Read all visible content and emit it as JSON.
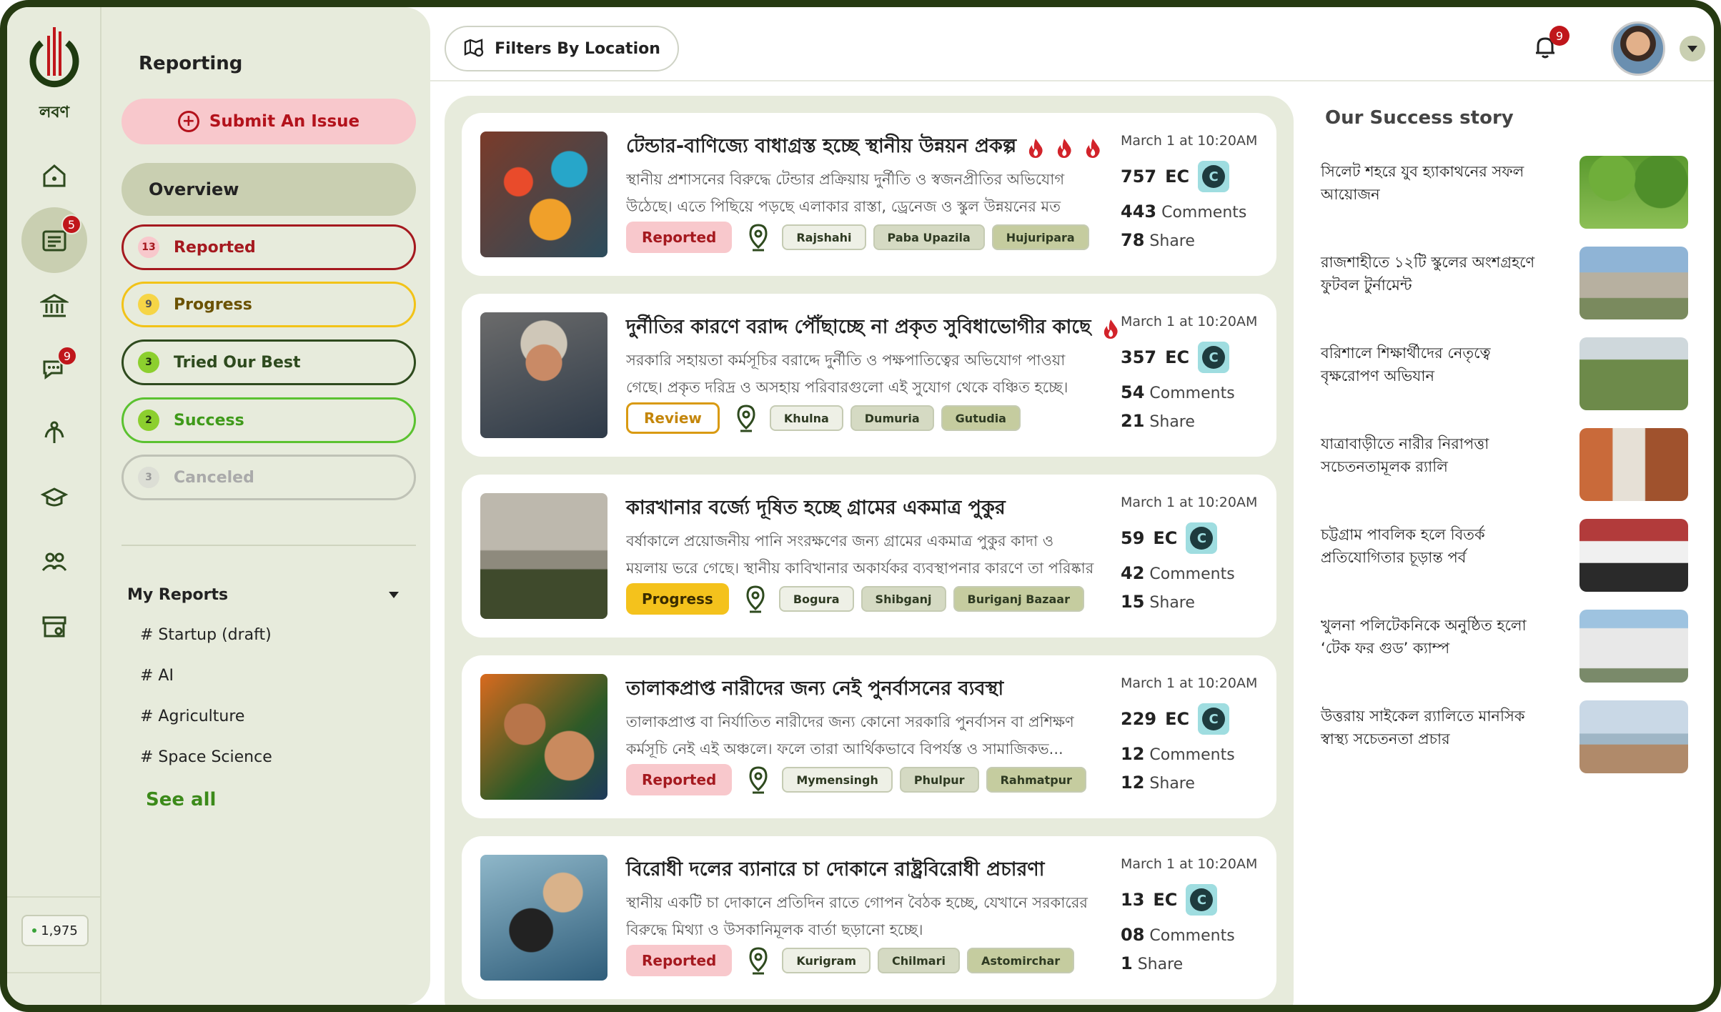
{
  "brand": {
    "logo_text": "লবণ"
  },
  "rail": {
    "items": [
      {
        "name": "home",
        "badge": ""
      },
      {
        "name": "reports",
        "badge": "5",
        "active": true
      },
      {
        "name": "institution",
        "badge": ""
      },
      {
        "name": "messages",
        "badge": "9"
      },
      {
        "name": "agriculture",
        "badge": ""
      },
      {
        "name": "education",
        "badge": ""
      },
      {
        "name": "community",
        "badge": ""
      },
      {
        "name": "marketplace",
        "badge": ""
      }
    ],
    "points": "1,975"
  },
  "sidebar": {
    "title": "Reporting",
    "submit_label": "Submit An Issue",
    "overview_label": "Overview",
    "statuses": [
      {
        "count": "13",
        "label": "Reported"
      },
      {
        "count": "9",
        "label": "Progress"
      },
      {
        "count": "3",
        "label": "Tried Our Best"
      },
      {
        "count": "2",
        "label": "Success"
      },
      {
        "count": "3",
        "label": "Canceled"
      }
    ],
    "my_reports_label": "My Reports",
    "my_reports": [
      "# Startup (draft)",
      "# AI",
      "# Agriculture",
      "# Space Science"
    ],
    "see_all": "See all"
  },
  "header": {
    "filter_label": "Filters By Location",
    "notification_count": "9"
  },
  "feed": [
    {
      "title": "টেন্ডার-বাণিজ্যে বাধাগ্রস্ত হচ্ছে স্থানীয় উন্নয়ন প্রকল্প",
      "fires": 3,
      "desc": "স্থানীয় প্রশাসনের বিরুদ্ধে টেন্ডার প্রক্রিয়ায় দুর্নীতি ও স্বজনপ্রীতির অভিযোগ উঠেছে। এতে পিছিয়ে পড়ছে এলাকার রাস্তা, ড্রেনেজ ও স্কুল উন্নয়নের মত গুরুত্বপূর্ণ প্রকল্প।",
      "status": "Reported",
      "locations": [
        "Rajshahi",
        "Paba Upazila",
        "Hujuripara"
      ],
      "date": "March 1 at 10:20AM",
      "ec": "757",
      "ec_label": "EC",
      "comments": "443",
      "comments_label": "Comments",
      "shares": "78",
      "shares_label": "Share"
    },
    {
      "title": "দুর্নীতির কারণে বরাদ্দ পৌঁছাচ্ছে না প্রকৃত সুবিধাভোগীর কাছে",
      "fires": 1,
      "desc": "সরকারি সহায়তা কর্মসূচির বরাদ্দে দুর্নীতি ও পক্ষপাতিত্বের অভিযোগ পাওয়া গেছে। প্রকৃত দরিদ্র ও অসহায় পরিবারগুলো এই সুযোগ থেকে বঞ্চিত হচ্ছে।",
      "status": "Review",
      "locations": [
        "Khulna",
        "Dumuria",
        "Gutudia"
      ],
      "date": "March 1 at 10:20AM",
      "ec": "357",
      "ec_label": "EC",
      "comments": "54",
      "comments_label": "Comments",
      "shares": "21",
      "shares_label": "Share"
    },
    {
      "title": "কারখানার বর্জ্যে দূষিত হচ্ছে গ্রামের একমাত্র পুকুর",
      "fires": 0,
      "desc": "বর্ষাকালে প্রয়োজনীয় পানি সংরক্ষণের জন্য গ্রামের একমাত্র পুকুর কাদা ও ময়লায় ভরে গেছে। স্থানীয় কাবিখানার অকার্যকর ব্যবস্থাপনার কারণে তা পরিষ্কার করা।",
      "status": "Progress",
      "locations": [
        "Bogura",
        "Shibganj",
        "Buriganj Bazaar"
      ],
      "date": "March 1 at 10:20AM",
      "ec": "59",
      "ec_label": "EC",
      "comments": "42",
      "comments_label": "Comments",
      "shares": "15",
      "shares_label": "Share"
    },
    {
      "title": "তালাকপ্রাপ্ত নারীদের জন্য নেই পুনর্বাসনের ব্যবস্থা",
      "fires": 0,
      "desc": "তালাকপ্রাপ্ত বা নির্যাতিত নারীদের জন্য কোনো সরকারি পুনর্বাসন বা প্রশিক্ষণ কর্মসূচি নেই এই অঞ্চলে। ফলে তারা আর্থিকভাবে বিপর্যস্ত ও সামাজিকভ...",
      "status": "Reported",
      "locations": [
        "Mymensingh",
        "Phulpur",
        "Rahmatpur"
      ],
      "date": "March 1 at 10:20AM",
      "ec": "229",
      "ec_label": "EC",
      "comments": "12",
      "comments_label": "Comments",
      "shares": "12",
      "shares_label": "Share"
    },
    {
      "title": "বিরোধী দলের ব্যানারে চা দোকানে রাষ্ট্রবিরোধী প্রচারণা",
      "fires": 0,
      "desc": "স্থানীয় একটি চা দোকানে প্রতিদিন রাতে গোপন বৈঠক হচ্ছে, যেখানে সরকারের বিরুদ্ধে মিথ্যা ও উসকানিমূলক বার্তা ছড়ানো হচ্ছে।",
      "status": "Reported",
      "locations": [
        "Kurigram",
        "Chilmari",
        "Astomirchar"
      ],
      "date": "March 1 at 10:20AM",
      "ec": "13",
      "ec_label": "EC",
      "comments": "08",
      "comments_label": "Comments",
      "shares": "1",
      "shares_label": "Share"
    }
  ],
  "success": {
    "title": "Our Success story",
    "stories": [
      "সিলেট শহরে যুব হ্যাকাথনের সফল আয়োজন",
      "রাজশাহীতে ১২টি স্কুলের অংশগ্রহণে ফুটবল টুর্নামেন্ট",
      "বরিশালে শিক্ষার্থীদের নেতৃত্বে বৃক্ষরোপণ অভিযান",
      "যাত্রাবাড়ীতে নারীর নিরাপত্তা সচেতনতামূলক র‍্যালি",
      "চট্টগ্রাম পাবলিক হলে বিতর্ক প্রতিযোগিতার চূড়ান্ত পর্ব",
      "খুলনা পলিটেকনিকে অনুষ্ঠিত হলো ‘টেক ফর গুড’ ক্যাম্প",
      "উত্তরায় সাইকেল র‍্যালিতে মানসিক স্বাস্থ্য সচেতনতা প্রচার"
    ]
  },
  "colors": {
    "brand_green": "#263a12",
    "panel": "#e7ebdc",
    "reported": "#a5191f",
    "progress": "#f2c318",
    "success": "#5bc230"
  }
}
